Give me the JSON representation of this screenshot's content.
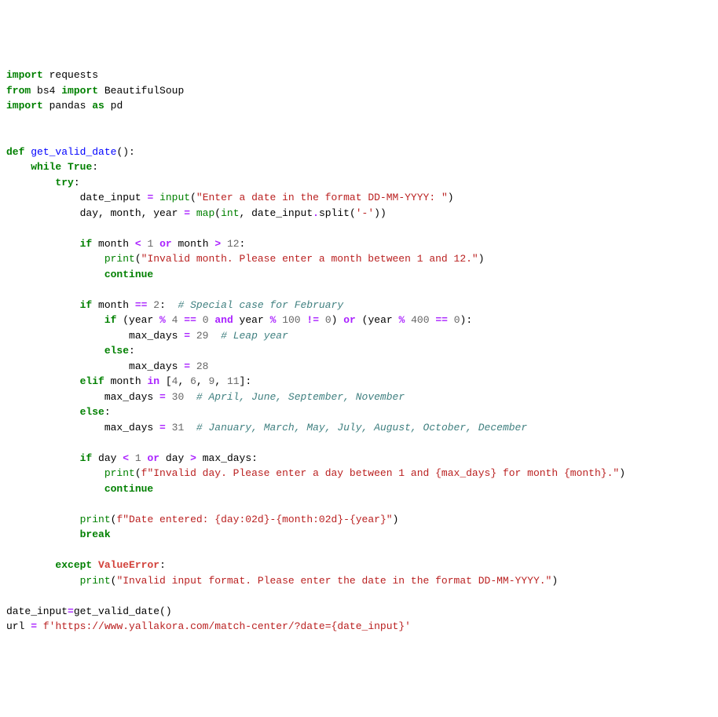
{
  "code": {
    "lines": [
      [
        {
          "t": "import",
          "c": "kw"
        },
        {
          "t": " requests",
          "c": ""
        }
      ],
      [
        {
          "t": "from",
          "c": "kw"
        },
        {
          "t": " bs4 ",
          "c": ""
        },
        {
          "t": "import",
          "c": "kw"
        },
        {
          "t": " BeautifulSoup",
          "c": ""
        }
      ],
      [
        {
          "t": "import",
          "c": "kw"
        },
        {
          "t": " pandas ",
          "c": ""
        },
        {
          "t": "as",
          "c": "kw"
        },
        {
          "t": " pd",
          "c": ""
        }
      ],
      [],
      [],
      [
        {
          "t": "def",
          "c": "kw"
        },
        {
          "t": " ",
          "c": ""
        },
        {
          "t": "get_valid_date",
          "c": "fn"
        },
        {
          "t": "():",
          "c": ""
        }
      ],
      [
        {
          "t": "    ",
          "c": ""
        },
        {
          "t": "while",
          "c": "kw"
        },
        {
          "t": " ",
          "c": ""
        },
        {
          "t": "True",
          "c": "bool"
        },
        {
          "t": ":",
          "c": ""
        }
      ],
      [
        {
          "t": "        ",
          "c": ""
        },
        {
          "t": "try",
          "c": "kw"
        },
        {
          "t": ":",
          "c": ""
        }
      ],
      [
        {
          "t": "            date_input ",
          "c": ""
        },
        {
          "t": "=",
          "c": "op"
        },
        {
          "t": " ",
          "c": ""
        },
        {
          "t": "input",
          "c": "bi"
        },
        {
          "t": "(",
          "c": ""
        },
        {
          "t": "\"Enter a date in the format DD-MM-YYYY: \"",
          "c": "str"
        },
        {
          "t": ")",
          "c": ""
        }
      ],
      [
        {
          "t": "            day, month, year ",
          "c": ""
        },
        {
          "t": "=",
          "c": "op"
        },
        {
          "t": " ",
          "c": ""
        },
        {
          "t": "map",
          "c": "bi"
        },
        {
          "t": "(",
          "c": ""
        },
        {
          "t": "int",
          "c": "bi"
        },
        {
          "t": ", date_input",
          "c": ""
        },
        {
          "t": ".",
          "c": "op"
        },
        {
          "t": "split(",
          "c": ""
        },
        {
          "t": "'-'",
          "c": "str"
        },
        {
          "t": "))",
          "c": ""
        }
      ],
      [],
      [
        {
          "t": "            ",
          "c": ""
        },
        {
          "t": "if",
          "c": "kw"
        },
        {
          "t": " month ",
          "c": ""
        },
        {
          "t": "<",
          "c": "op"
        },
        {
          "t": " ",
          "c": ""
        },
        {
          "t": "1",
          "c": "num"
        },
        {
          "t": " ",
          "c": ""
        },
        {
          "t": "or",
          "c": "op"
        },
        {
          "t": " month ",
          "c": ""
        },
        {
          "t": ">",
          "c": "op"
        },
        {
          "t": " ",
          "c": ""
        },
        {
          "t": "12",
          "c": "num"
        },
        {
          "t": ":",
          "c": ""
        }
      ],
      [
        {
          "t": "                ",
          "c": ""
        },
        {
          "t": "print",
          "c": "bi"
        },
        {
          "t": "(",
          "c": ""
        },
        {
          "t": "\"Invalid month. Please enter a month between 1 and 12.\"",
          "c": "str"
        },
        {
          "t": ")",
          "c": ""
        }
      ],
      [
        {
          "t": "                ",
          "c": ""
        },
        {
          "t": "continue",
          "c": "kw"
        }
      ],
      [],
      [
        {
          "t": "            ",
          "c": ""
        },
        {
          "t": "if",
          "c": "kw"
        },
        {
          "t": " month ",
          "c": ""
        },
        {
          "t": "==",
          "c": "op"
        },
        {
          "t": " ",
          "c": ""
        },
        {
          "t": "2",
          "c": "num"
        },
        {
          "t": ":  ",
          "c": ""
        },
        {
          "t": "# Special case for February",
          "c": "com"
        }
      ],
      [
        {
          "t": "                ",
          "c": ""
        },
        {
          "t": "if",
          "c": "kw"
        },
        {
          "t": " (year ",
          "c": ""
        },
        {
          "t": "%",
          "c": "op"
        },
        {
          "t": " ",
          "c": ""
        },
        {
          "t": "4",
          "c": "num"
        },
        {
          "t": " ",
          "c": ""
        },
        {
          "t": "==",
          "c": "op"
        },
        {
          "t": " ",
          "c": ""
        },
        {
          "t": "0",
          "c": "num"
        },
        {
          "t": " ",
          "c": ""
        },
        {
          "t": "and",
          "c": "op"
        },
        {
          "t": " year ",
          "c": ""
        },
        {
          "t": "%",
          "c": "op"
        },
        {
          "t": " ",
          "c": ""
        },
        {
          "t": "100",
          "c": "num"
        },
        {
          "t": " ",
          "c": ""
        },
        {
          "t": "!=",
          "c": "op"
        },
        {
          "t": " ",
          "c": ""
        },
        {
          "t": "0",
          "c": "num"
        },
        {
          "t": ") ",
          "c": ""
        },
        {
          "t": "or",
          "c": "op"
        },
        {
          "t": " (year ",
          "c": ""
        },
        {
          "t": "%",
          "c": "op"
        },
        {
          "t": " ",
          "c": ""
        },
        {
          "t": "400",
          "c": "num"
        },
        {
          "t": " ",
          "c": ""
        },
        {
          "t": "==",
          "c": "op"
        },
        {
          "t": " ",
          "c": ""
        },
        {
          "t": "0",
          "c": "num"
        },
        {
          "t": "):",
          "c": ""
        }
      ],
      [
        {
          "t": "                    max_days ",
          "c": ""
        },
        {
          "t": "=",
          "c": "op"
        },
        {
          "t": " ",
          "c": ""
        },
        {
          "t": "29",
          "c": "num"
        },
        {
          "t": "  ",
          "c": ""
        },
        {
          "t": "# Leap year",
          "c": "com"
        }
      ],
      [
        {
          "t": "                ",
          "c": ""
        },
        {
          "t": "else",
          "c": "kw"
        },
        {
          "t": ":",
          "c": ""
        }
      ],
      [
        {
          "t": "                    max_days ",
          "c": ""
        },
        {
          "t": "=",
          "c": "op"
        },
        {
          "t": " ",
          "c": ""
        },
        {
          "t": "28",
          "c": "num"
        }
      ],
      [
        {
          "t": "            ",
          "c": ""
        },
        {
          "t": "elif",
          "c": "kw"
        },
        {
          "t": " month ",
          "c": ""
        },
        {
          "t": "in",
          "c": "op"
        },
        {
          "t": " [",
          "c": ""
        },
        {
          "t": "4",
          "c": "num"
        },
        {
          "t": ", ",
          "c": ""
        },
        {
          "t": "6",
          "c": "num"
        },
        {
          "t": ", ",
          "c": ""
        },
        {
          "t": "9",
          "c": "num"
        },
        {
          "t": ", ",
          "c": ""
        },
        {
          "t": "11",
          "c": "num"
        },
        {
          "t": "]:",
          "c": ""
        }
      ],
      [
        {
          "t": "                max_days ",
          "c": ""
        },
        {
          "t": "=",
          "c": "op"
        },
        {
          "t": " ",
          "c": ""
        },
        {
          "t": "30",
          "c": "num"
        },
        {
          "t": "  ",
          "c": ""
        },
        {
          "t": "# April, June, September, November",
          "c": "com"
        }
      ],
      [
        {
          "t": "            ",
          "c": ""
        },
        {
          "t": "else",
          "c": "kw"
        },
        {
          "t": ":",
          "c": ""
        }
      ],
      [
        {
          "t": "                max_days ",
          "c": ""
        },
        {
          "t": "=",
          "c": "op"
        },
        {
          "t": " ",
          "c": ""
        },
        {
          "t": "31",
          "c": "num"
        },
        {
          "t": "  ",
          "c": ""
        },
        {
          "t": "# January, March, May, July, August, October, December",
          "c": "com"
        }
      ],
      [],
      [
        {
          "t": "            ",
          "c": ""
        },
        {
          "t": "if",
          "c": "kw"
        },
        {
          "t": " day ",
          "c": ""
        },
        {
          "t": "<",
          "c": "op"
        },
        {
          "t": " ",
          "c": ""
        },
        {
          "t": "1",
          "c": "num"
        },
        {
          "t": " ",
          "c": ""
        },
        {
          "t": "or",
          "c": "op"
        },
        {
          "t": " day ",
          "c": ""
        },
        {
          "t": ">",
          "c": "op"
        },
        {
          "t": " max_days:",
          "c": ""
        }
      ],
      [
        {
          "t": "                ",
          "c": ""
        },
        {
          "t": "print",
          "c": "bi"
        },
        {
          "t": "(",
          "c": ""
        },
        {
          "t": "f\"Invalid day. Please enter a day between 1 and ",
          "c": "str"
        },
        {
          "t": "{max_days}",
          "c": "str"
        },
        {
          "t": " for month ",
          "c": "str"
        },
        {
          "t": "{month}",
          "c": "str"
        },
        {
          "t": ".\"",
          "c": "str"
        },
        {
          "t": ")",
          "c": ""
        }
      ],
      [
        {
          "t": "                ",
          "c": ""
        },
        {
          "t": "continue",
          "c": "kw"
        }
      ],
      [],
      [
        {
          "t": "            ",
          "c": ""
        },
        {
          "t": "print",
          "c": "bi"
        },
        {
          "t": "(",
          "c": ""
        },
        {
          "t": "f\"Date entered: ",
          "c": "str"
        },
        {
          "t": "{day:02d}",
          "c": "str"
        },
        {
          "t": "-",
          "c": "str"
        },
        {
          "t": "{month:02d}",
          "c": "str"
        },
        {
          "t": "-",
          "c": "str"
        },
        {
          "t": "{year}",
          "c": "str"
        },
        {
          "t": "\"",
          "c": "str"
        },
        {
          "t": ")",
          "c": ""
        }
      ],
      [
        {
          "t": "            ",
          "c": ""
        },
        {
          "t": "break",
          "c": "kw"
        }
      ],
      [],
      [
        {
          "t": "        ",
          "c": ""
        },
        {
          "t": "except",
          "c": "kw"
        },
        {
          "t": " ",
          "c": ""
        },
        {
          "t": "ValueError",
          "c": "exc"
        },
        {
          "t": ":",
          "c": ""
        }
      ],
      [
        {
          "t": "            ",
          "c": ""
        },
        {
          "t": "print",
          "c": "bi"
        },
        {
          "t": "(",
          "c": ""
        },
        {
          "t": "\"Invalid input format. Please enter the date in the format DD-MM-YYYY.\"",
          "c": "str"
        },
        {
          "t": ")",
          "c": ""
        }
      ],
      [],
      [
        {
          "t": "date_input",
          "c": ""
        },
        {
          "t": "=",
          "c": "op"
        },
        {
          "t": "get_valid_date()",
          "c": ""
        }
      ],
      [
        {
          "t": "url ",
          "c": ""
        },
        {
          "t": "=",
          "c": "op"
        },
        {
          "t": " ",
          "c": ""
        },
        {
          "t": "f'https://www.yallakora.com/match-center/?date=",
          "c": "str"
        },
        {
          "t": "{date_input}",
          "c": "str"
        },
        {
          "t": "'",
          "c": "str"
        }
      ]
    ]
  }
}
